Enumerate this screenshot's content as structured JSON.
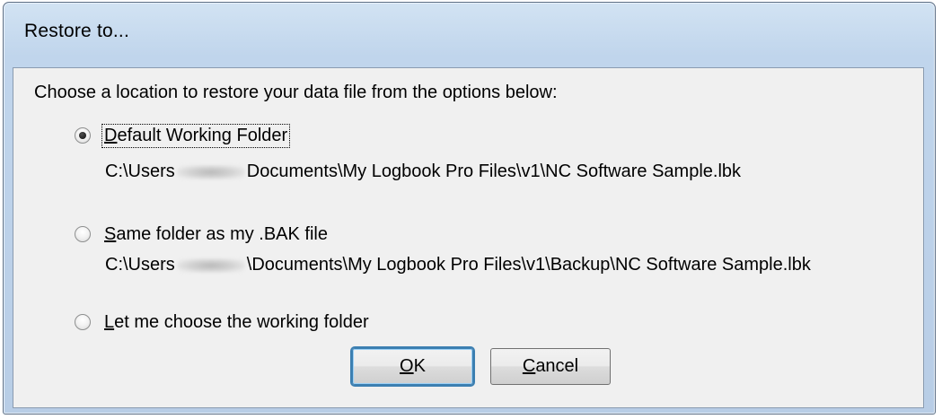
{
  "window": {
    "title": "Restore to..."
  },
  "dialog": {
    "instruction": "Choose a location to restore your data file from the options below:",
    "options": [
      {
        "label_accel": "D",
        "label_rest": "efault Working Folder",
        "checked": true,
        "path_prefix": "C:\\Users",
        "path_suffix": "Documents\\My Logbook Pro Files\\v1\\NC Software Sample.lbk"
      },
      {
        "label_accel": "S",
        "label_rest": "ame folder as my .BAK file",
        "checked": false,
        "path_prefix": "C:\\Users",
        "path_suffix": "\\Documents\\My Logbook Pro Files\\v1\\Backup\\NC Software Sample.lbk"
      },
      {
        "label_accel": "L",
        "label_rest": "et me choose the working folder",
        "checked": false
      }
    ],
    "ok_accel": "O",
    "ok_rest": "K",
    "cancel_accel": "C",
    "cancel_rest": "ancel"
  }
}
